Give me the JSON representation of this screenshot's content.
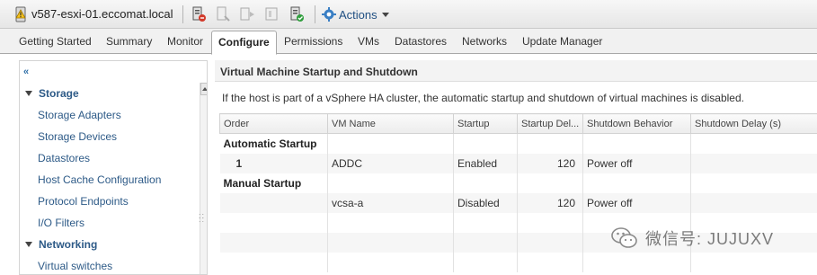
{
  "window": {
    "host_name": "v587-esxi-01.eccomat.local",
    "actions_label": "Actions"
  },
  "toolbar_icons": [
    "add-host-icon",
    "enter-maintenance-icon",
    "power-icon",
    "storage-icon",
    "remove-host-icon",
    "actions-gear-icon"
  ],
  "tabs": [
    {
      "label": "Getting Started"
    },
    {
      "label": "Summary"
    },
    {
      "label": "Monitor"
    },
    {
      "label": "Configure",
      "active": true
    },
    {
      "label": "Permissions"
    },
    {
      "label": "VMs"
    },
    {
      "label": "Datastores"
    },
    {
      "label": "Networks"
    },
    {
      "label": "Update Manager"
    }
  ],
  "sidebar": {
    "collapse_glyph": "«",
    "groups": [
      {
        "label": "Storage",
        "items": [
          "Storage Adapters",
          "Storage Devices",
          "Datastores",
          "Host Cache Configuration",
          "Protocol Endpoints",
          "I/O Filters"
        ]
      },
      {
        "label": "Networking",
        "items": [
          "Virtual switches"
        ]
      }
    ]
  },
  "main": {
    "section_title": "Virtual Machine Startup and Shutdown",
    "ha_note": "If the host is part of a vSphere HA cluster, the automatic startup and shutdown of virtual machines is disabled.",
    "table": {
      "columns": [
        "Order",
        "VM Name",
        "Startup",
        "Startup Del...",
        "Shutdown Behavior",
        "Shutdown Delay (s)"
      ],
      "rows": [
        {
          "type": "group",
          "label": "Automatic Startup"
        },
        {
          "type": "vm",
          "order": "1",
          "vm_name": "ADDC",
          "startup": "Enabled",
          "startup_delay": "120",
          "shutdown_behavior": "Power off",
          "shutdown_delay": ""
        },
        {
          "type": "group",
          "label": "Manual Startup"
        },
        {
          "type": "vm",
          "order": "",
          "vm_name": "vcsa-a",
          "startup": "Disabled",
          "startup_delay": "120",
          "shutdown_behavior": "Power off",
          "shutdown_delay": ""
        },
        {
          "type": "empty"
        },
        {
          "type": "empty"
        },
        {
          "type": "empty"
        }
      ]
    }
  },
  "watermark": {
    "text": "微信号: JUJUXV",
    "icon": "wechat-logo-icon"
  },
  "colors": {
    "link_blue": "#2d5a87",
    "accent_blue": "#1f4f82"
  }
}
